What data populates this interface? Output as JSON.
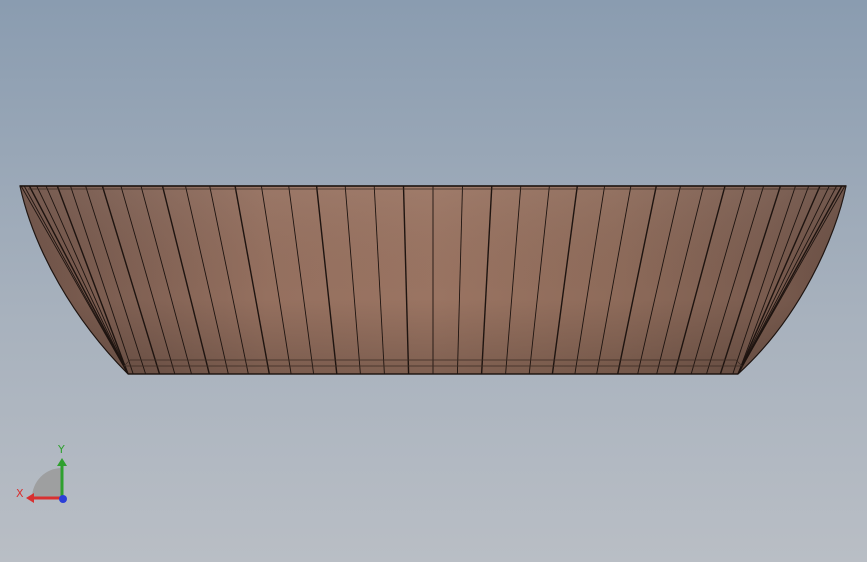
{
  "viewport": {
    "background_top": "#8a9cb0",
    "background_bottom": "#b9bec5"
  },
  "model": {
    "name": "bowl-part-front-view",
    "face_color": "#8f6b5c",
    "edge_color": "#1e1410"
  },
  "triad": {
    "x_label": "X",
    "y_label": "Y",
    "x_color": "#d83030",
    "y_color": "#2fa02f",
    "z_color": "#2b3fd8"
  }
}
